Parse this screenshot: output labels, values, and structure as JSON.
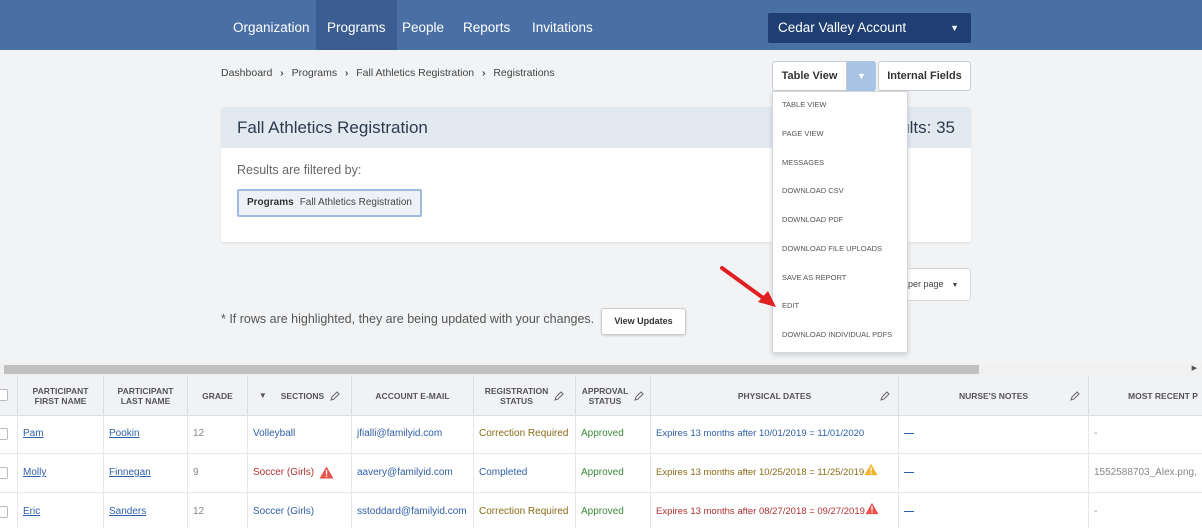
{
  "nav": {
    "items": [
      {
        "label": "Organization",
        "active": false
      },
      {
        "label": "Programs",
        "active": true
      },
      {
        "label": "People",
        "active": false
      },
      {
        "label": "Reports",
        "active": false
      },
      {
        "label": "Invitations",
        "active": false
      }
    ],
    "account": "Cedar Valley Account"
  },
  "breadcrumb": [
    "Dashboard",
    "Programs",
    "Fall Athletics Registration",
    "Registrations"
  ],
  "view": {
    "table_view_label": "Table View",
    "internal_fields_label": "Internal Fields"
  },
  "dropdown": {
    "items": [
      "TABLE VIEW",
      "PAGE VIEW",
      "MESSAGES",
      "DOWNLOAD CSV",
      "DOWNLOAD PDF",
      "DOWNLOAD FILE UPLOADS",
      "SAVE AS REPORT",
      "EDIT",
      "DOWNLOAD INDIVIDUAL PDFS"
    ]
  },
  "card": {
    "title": "Fall Athletics Registration",
    "results": "ults: 35",
    "filter_label": "Results are filtered by:",
    "chip_key": "Programs",
    "chip_value": "Fall Athletics Registration"
  },
  "per_page": "per page",
  "note": "* If rows are highlighted, they are being updated with your changes.",
  "view_updates_label": "View Updates",
  "table": {
    "headers": {
      "first": [
        "PARTICIPANT",
        "FIRST NAME"
      ],
      "last": [
        "PARTICIPANT",
        "LAST NAME"
      ],
      "grade": "GRADE",
      "sections": "SECTIONS",
      "email": "ACCOUNT E-MAIL",
      "reg": [
        "REGISTRATION",
        "STATUS"
      ],
      "appr": [
        "APPROVAL",
        "STATUS"
      ],
      "physical": "PHYSICAL DATES",
      "nurse": "NURSE'S NOTES",
      "recent": "MOST RECENT P"
    },
    "rows": [
      {
        "first": "Pam",
        "last": "Pookin",
        "grade": "12",
        "section": "Volleyball",
        "email": "jfialli@familyid.com",
        "reg": "Correction Required",
        "appr": "Approved",
        "physical": "Expires 13 months after 10/01/2019 = 11/01/2020",
        "nurse": "—",
        "recent": "-"
      },
      {
        "first": "Molly",
        "last": "Finnegan",
        "grade": "9",
        "section": "Soccer (Girls)",
        "email": "aavery@familyid.com",
        "reg": "Completed",
        "appr": "Approved",
        "physical": "Expires 13 months after 10/25/2018 = 11/25/2019",
        "nurse": "—",
        "recent": "1552588703_Alex.png,"
      },
      {
        "first": "Eric",
        "last": "Sanders",
        "grade": "12",
        "section": "Soccer (Girls)",
        "email": "sstoddard@familyid.com",
        "reg": "Correction Required",
        "appr": "Approved",
        "physical": "Expires 13 months after 08/27/2018 = 09/27/2019",
        "nurse": "—",
        "recent": "-"
      }
    ]
  },
  "colors": {
    "nav": "#4a6fa5",
    "nav_active": "#3b5d91",
    "account": "#1f3f73",
    "link": "#2e5fa8",
    "warning": "#e8524a"
  }
}
